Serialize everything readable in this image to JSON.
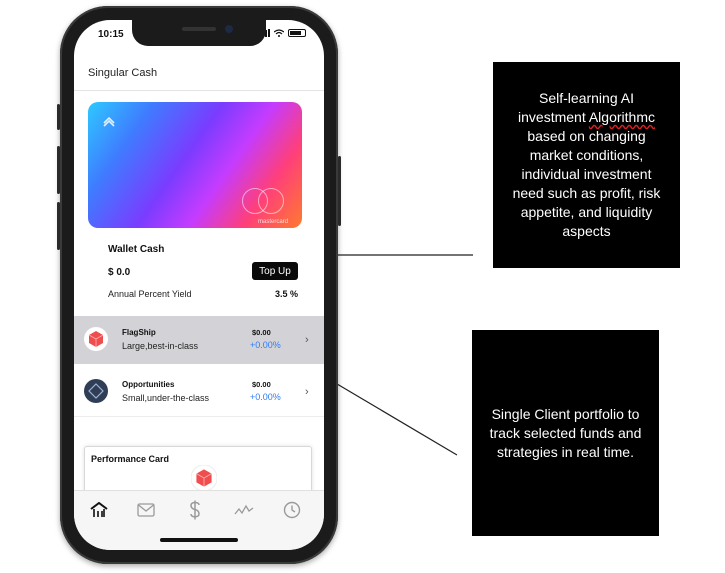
{
  "status_bar": {
    "time": "10:15"
  },
  "app": {
    "title": "Singular Cash"
  },
  "card": {
    "brand": "mastercard"
  },
  "wallet": {
    "title": "Wallet Cash",
    "amount": "$ 0.0",
    "topup_label": "Top Up",
    "apy_label": "Annual Percent Yield",
    "apy_value": "3.5 %"
  },
  "portfolios": [
    {
      "name": "FlagShip",
      "description": "Large,best-in-class",
      "amount": "$0.00",
      "change": "+0.00%"
    },
    {
      "name": "Opportunities",
      "description": "Small,under-the-class",
      "amount": "$0.00",
      "change": "+0.00%"
    }
  ],
  "performance_card": {
    "title": "Performance Card"
  },
  "tabs": [
    "home-icon",
    "mail-icon",
    "dollar-icon",
    "activity-icon",
    "clock-icon"
  ],
  "callouts": {
    "first_before": "Self-learning AI investment ",
    "first_highlight": "Algorithmc",
    "first_after": " based on changing market conditions, individual investment need such as profit, risk appetite, and liquidity aspects",
    "second": "Single Client portfolio to track selected funds and strategies in real time."
  },
  "colors": {
    "accent_blue": "#2e7cf6",
    "flagship_red": "#f04e4e",
    "opportunities_navy": "#2f3d55",
    "highlight_row": "#d3d3d7"
  }
}
